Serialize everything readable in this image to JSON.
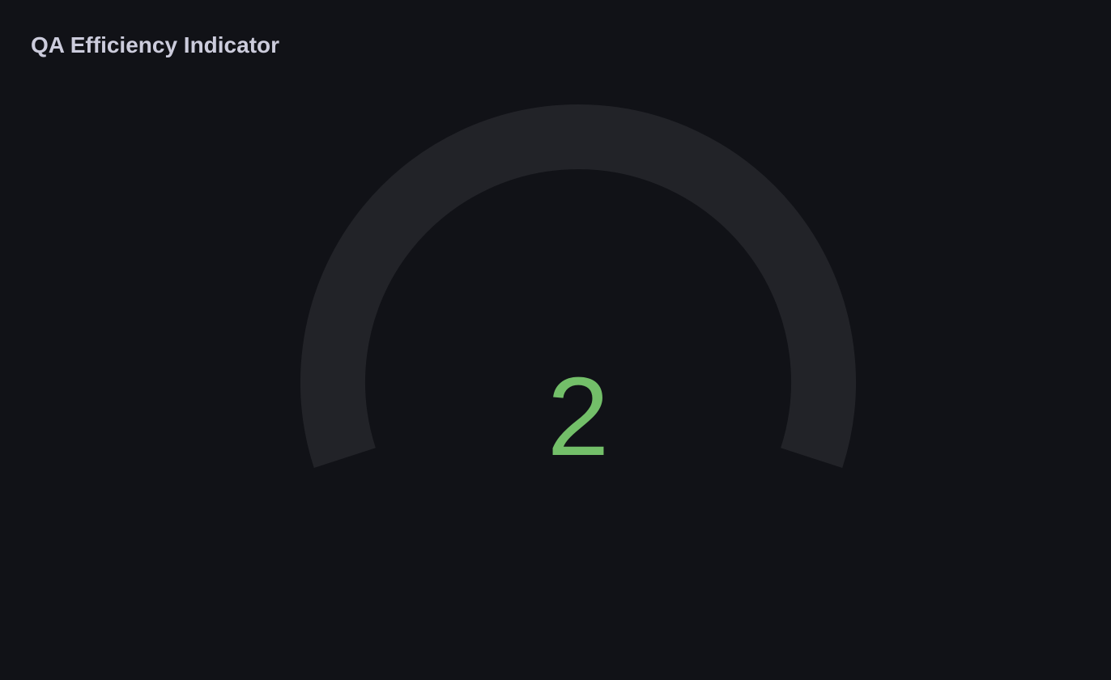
{
  "panel": {
    "title": "QA Efficiency Indicator"
  },
  "gauge": {
    "value": 2,
    "value_text": "2",
    "value_fraction": 0,
    "colors": {
      "value": "#73bf69",
      "track": "#222328",
      "background": "#111217",
      "title": "#ccccdc"
    }
  }
}
